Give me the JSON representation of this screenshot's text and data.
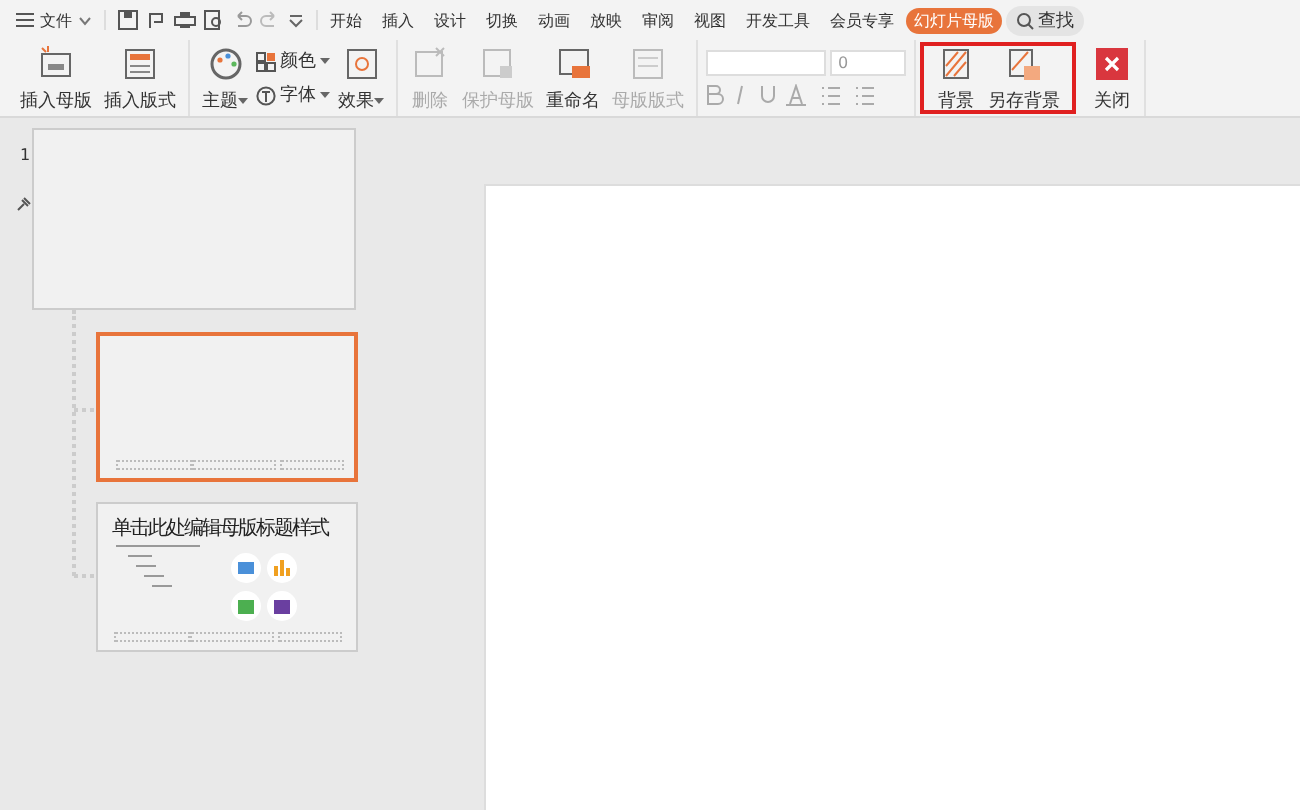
{
  "menu_bar": {
    "file_label": "文件",
    "tabs": [
      {
        "label": "开始",
        "selected": false
      },
      {
        "label": "插入",
        "selected": false
      },
      {
        "label": "设计",
        "selected": false
      },
      {
        "label": "切换",
        "selected": false
      },
      {
        "label": "动画",
        "selected": false
      },
      {
        "label": "放映",
        "selected": false
      },
      {
        "label": "审阅",
        "selected": false
      },
      {
        "label": "视图",
        "selected": false
      },
      {
        "label": "开发工具",
        "selected": false
      },
      {
        "label": "会员专享",
        "selected": false
      },
      {
        "label": "幻灯片母版",
        "selected": true
      }
    ],
    "search": "查找"
  },
  "ribbon": {
    "groups": [
      {
        "highlighted": false,
        "items": [
          {
            "kind": "big",
            "label": "插入母版",
            "disabled": false,
            "caret": false
          },
          {
            "kind": "big",
            "label": "插入版式",
            "disabled": false,
            "caret": false
          }
        ]
      },
      {
        "highlighted": false,
        "items": [
          {
            "kind": "big",
            "label": "主题",
            "disabled": false,
            "caret": true
          },
          {
            "kind": "pair",
            "top": "颜色",
            "bottom": "字体",
            "disabled": false,
            "caret": true
          },
          {
            "kind": "big",
            "label": "效果",
            "disabled": false,
            "caret": true
          }
        ]
      },
      {
        "highlighted": false,
        "items": [
          {
            "kind": "big",
            "label": "删除",
            "disabled": true,
            "caret": false
          },
          {
            "kind": "big",
            "label": "保护母版",
            "disabled": true,
            "caret": false
          },
          {
            "kind": "big",
            "label": "重命名",
            "disabled": false,
            "caret": false
          },
          {
            "kind": "big",
            "label": "母版版式",
            "disabled": true,
            "caret": false
          }
        ]
      },
      {
        "highlighted": false,
        "items": [
          {
            "kind": "font",
            "size": "0",
            "disabled": true
          }
        ]
      },
      {
        "highlighted": true,
        "items": [
          {
            "kind": "big",
            "label": "背景",
            "disabled": false,
            "caret": false
          },
          {
            "kind": "big",
            "label": "另存背景",
            "disabled": false,
            "caret": false
          }
        ]
      },
      {
        "highlighted": false,
        "items": [
          {
            "kind": "big",
            "label": "关闭",
            "disabled": false,
            "caret": false
          }
        ]
      }
    ]
  },
  "thumbnails": [
    {
      "kind": "master",
      "number": "1",
      "selected": false
    },
    {
      "kind": "footer",
      "selected": true
    },
    {
      "kind": "content",
      "title": "单击此处编辑母版标题样式",
      "selected": false
    }
  ]
}
